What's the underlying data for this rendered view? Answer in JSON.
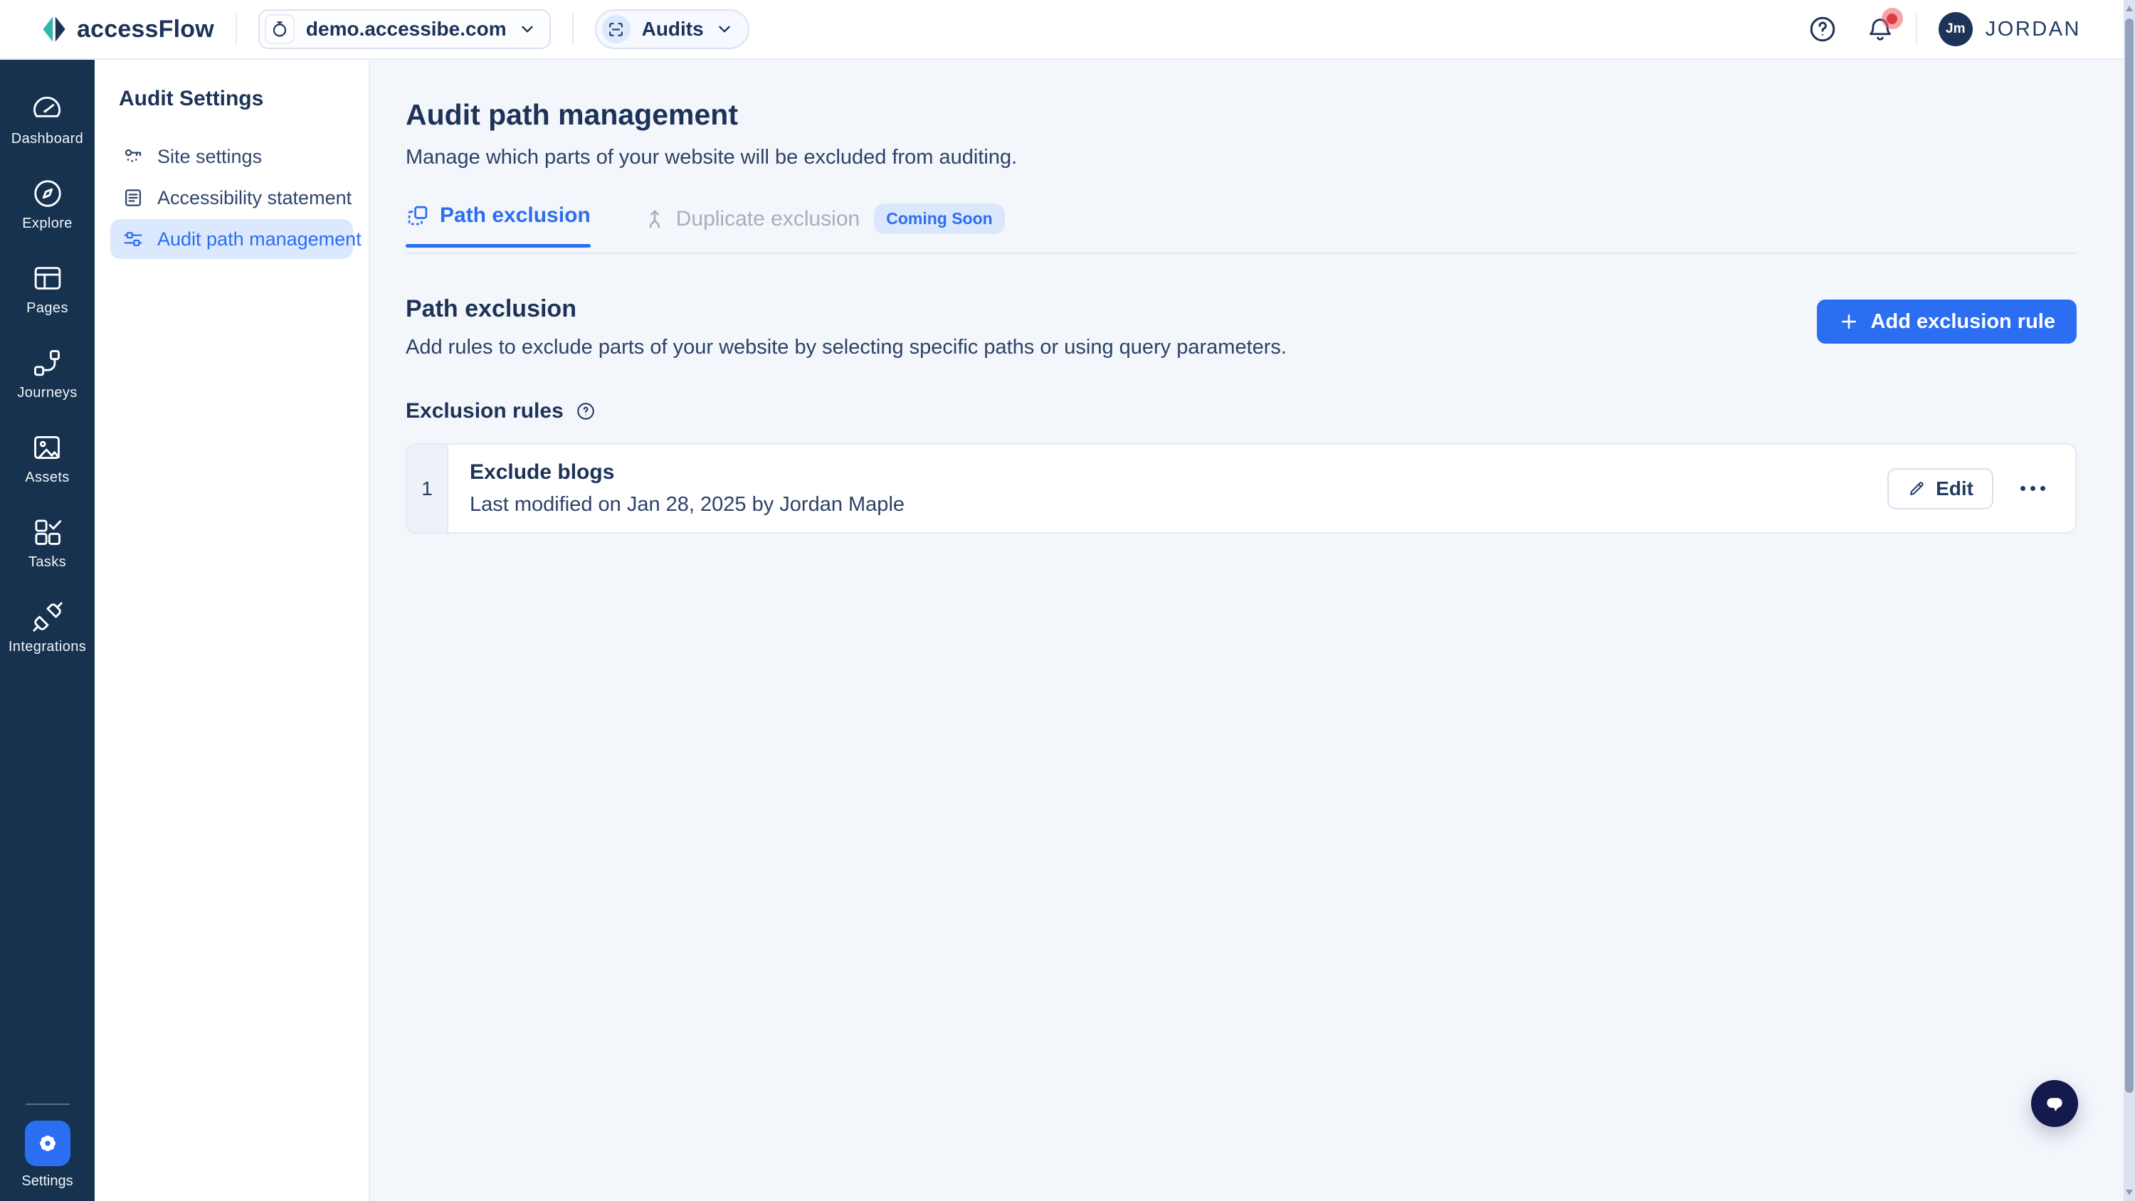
{
  "colors": {
    "accent": "#2b6ef2",
    "rail_bg": "#16324f",
    "navy": "#1c3357",
    "page_bg": "#f3f6fb",
    "badge_bg": "#dbe7fd",
    "notification_red": "#e03a46"
  },
  "header": {
    "brand": "accessFlow",
    "site_dropdown": {
      "value": "demo.accessibe.com"
    },
    "audits_dropdown": {
      "value": "Audits"
    },
    "user_initials": "Jm",
    "user_name": "JORDAN"
  },
  "rail": {
    "items": [
      {
        "label": "Dashboard"
      },
      {
        "label": "Explore"
      },
      {
        "label": "Pages"
      },
      {
        "label": "Journeys"
      },
      {
        "label": "Assets"
      },
      {
        "label": "Tasks"
      },
      {
        "label": "Integrations"
      }
    ],
    "settings_label": "Settings"
  },
  "subnav": {
    "title": "Audit Settings",
    "items": [
      {
        "label": "Site settings",
        "active": false
      },
      {
        "label": "Accessibility statement",
        "active": false
      },
      {
        "label": "Audit path management",
        "active": true
      }
    ]
  },
  "main": {
    "title": "Audit path management",
    "subtitle": "Manage which parts of your website will be excluded from auditing.",
    "tabs": {
      "path": {
        "label": "Path exclusion",
        "active": true
      },
      "duplicate": {
        "label": "Duplicate exclusion",
        "badge": "Coming Soon",
        "active": false
      }
    },
    "section": {
      "title": "Path exclusion",
      "description": "Add rules to exclude parts of your website by selecting specific paths or using query parameters.",
      "add_button_label": "Add exclusion rule"
    },
    "rules": {
      "heading": "Exclusion rules",
      "rows": [
        {
          "index": "1",
          "name": "Exclude blogs",
          "meta": "Last modified on Jan 28, 2025 by Jordan Maple",
          "edit_label": "Edit"
        }
      ]
    }
  }
}
